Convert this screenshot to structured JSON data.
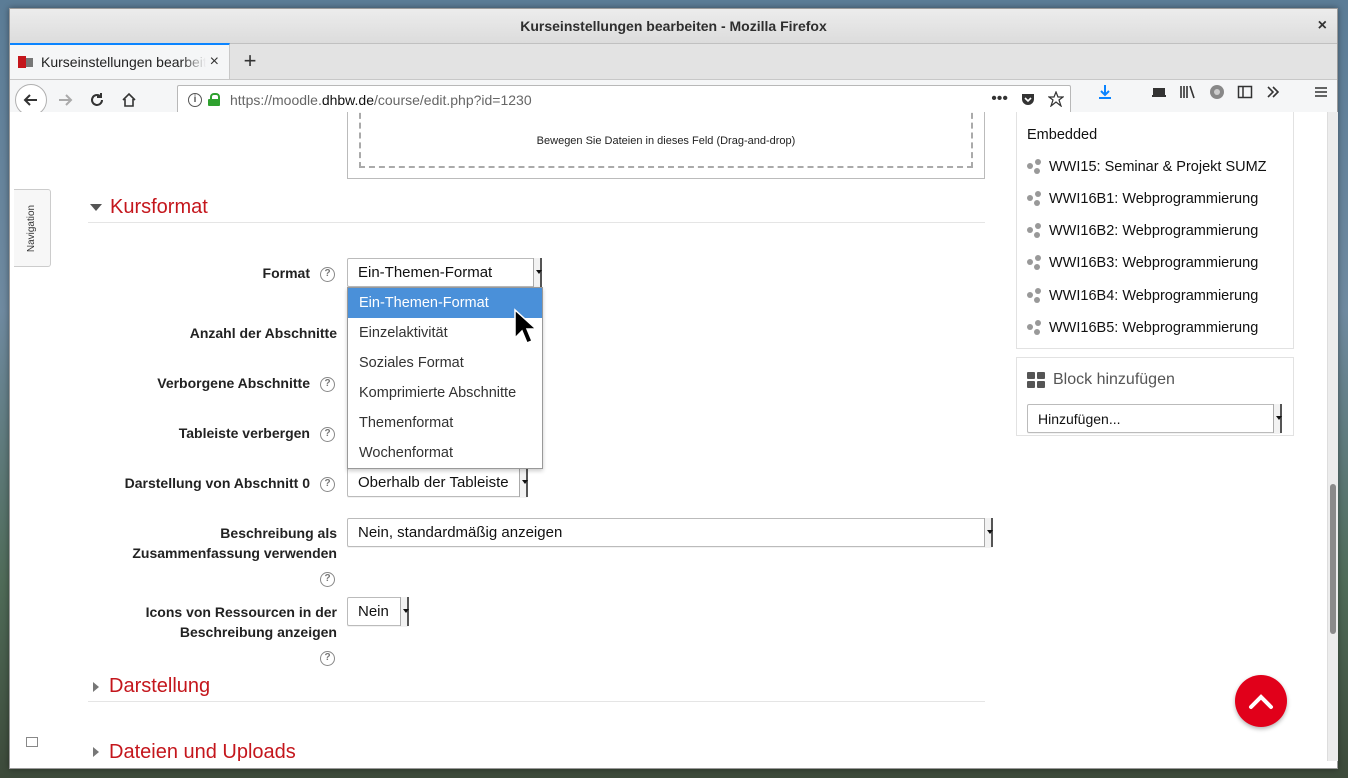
{
  "window": {
    "title": "Kurseinstellungen bearbeiten - Mozilla Firefox",
    "close": "×"
  },
  "tabs": [
    {
      "label": "Kurseinstellungen bearbeiten",
      "close": "×"
    }
  ],
  "newtab": "+",
  "url": {
    "prefix": "https://moodle.",
    "domain": "dhbw.de",
    "path": "/course/edit.php?id=1230"
  },
  "dropzone": {
    "hint": "Bewegen Sie Dateien in dieses Feld (Drag-and-drop)"
  },
  "nav_drawer": {
    "label": "Navigation"
  },
  "sections": {
    "kursformat": "Kursformat",
    "darstellung": "Darstellung",
    "dateien": "Dateien und Uploads"
  },
  "form": {
    "format_label": "Format",
    "format_value": "Ein-Themen-Format",
    "anzahl_label": "Anzahl der Abschnitte",
    "verborgene_label": "Verborgene Abschnitte",
    "tableiste_label": "Tableiste verbergen",
    "abschnitt0_label": "Darstellung von Abschnitt 0",
    "abschnitt0_value": "Oberhalb der Tableiste",
    "beschreibung_label_1": "Beschreibung als",
    "beschreibung_label_2": "Zusammenfassung verwenden",
    "beschreibung_value": "Nein, standardmäßig anzeigen",
    "icons_label_1": "Icons von Ressourcen in der",
    "icons_label_2": "Beschreibung anzeigen",
    "icons_value": "Nein",
    "help": "?"
  },
  "format_options": [
    "Ein-Themen-Format",
    "Einzelaktivität",
    "Soziales Format",
    "Komprimierte Abschnitte",
    "Themenformat",
    "Wochenformat"
  ],
  "sidebar": {
    "heading": "Embedded",
    "items": [
      "WWI15: Seminar & Projekt SUMZ",
      "WWI16B1: Webprogrammierung",
      "WWI16B2: Webprogrammierung",
      "WWI16B3: Webprogrammierung",
      "WWI16B4: Webprogrammierung",
      "WWI16B5: Webprogrammierung"
    ],
    "add_block_title": "Block hinzufügen",
    "add_block_value": "Hinzufügen..."
  },
  "colors": {
    "accent": "#c4161c",
    "selected": "#4a90d9",
    "scroll_top": "#e1001a"
  }
}
